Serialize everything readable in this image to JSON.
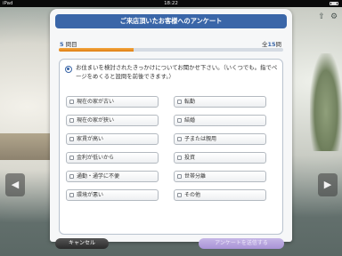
{
  "status_bar": {
    "carrier": "iPad",
    "time": "18:22"
  },
  "survey": {
    "title": "ご来店頂いたお客様へのアンケート",
    "progress": {
      "current": "5",
      "current_suffix": "問目",
      "total_prefix": "全",
      "total": "15",
      "total_suffix": "問",
      "fraction": 0.333
    },
    "question": "お住まいを検討されたきっかけについてお聞かせ下さい。（いくつでも。指でページをめくると設問を前後できます。）",
    "options": [
      {
        "label": "現在の家が古い"
      },
      {
        "label": "転勤"
      },
      {
        "label": "現在の家が狭い"
      },
      {
        "label": "結婚"
      },
      {
        "label": "家賃が高い"
      },
      {
        "label": "子または親用"
      },
      {
        "label": "金利が低いから"
      },
      {
        "label": "投資"
      },
      {
        "label": "通勤・通学に不便"
      },
      {
        "label": "世帯分離"
      },
      {
        "label": "環境が悪い"
      },
      {
        "label": "その他"
      }
    ],
    "cancel_label": "キャンセル",
    "next_label": "アンケートを送信する"
  },
  "icons": {
    "back": "back-arrow-icon",
    "forward": "forward-arrow-icon",
    "settings": "gear-icon",
    "share": "share-icon",
    "question": "radio-icon"
  },
  "colors": {
    "header": "#3a66a8",
    "progress_fill": "#e8912a",
    "next_button": "#a892d6",
    "cancel_button": "#333333"
  }
}
